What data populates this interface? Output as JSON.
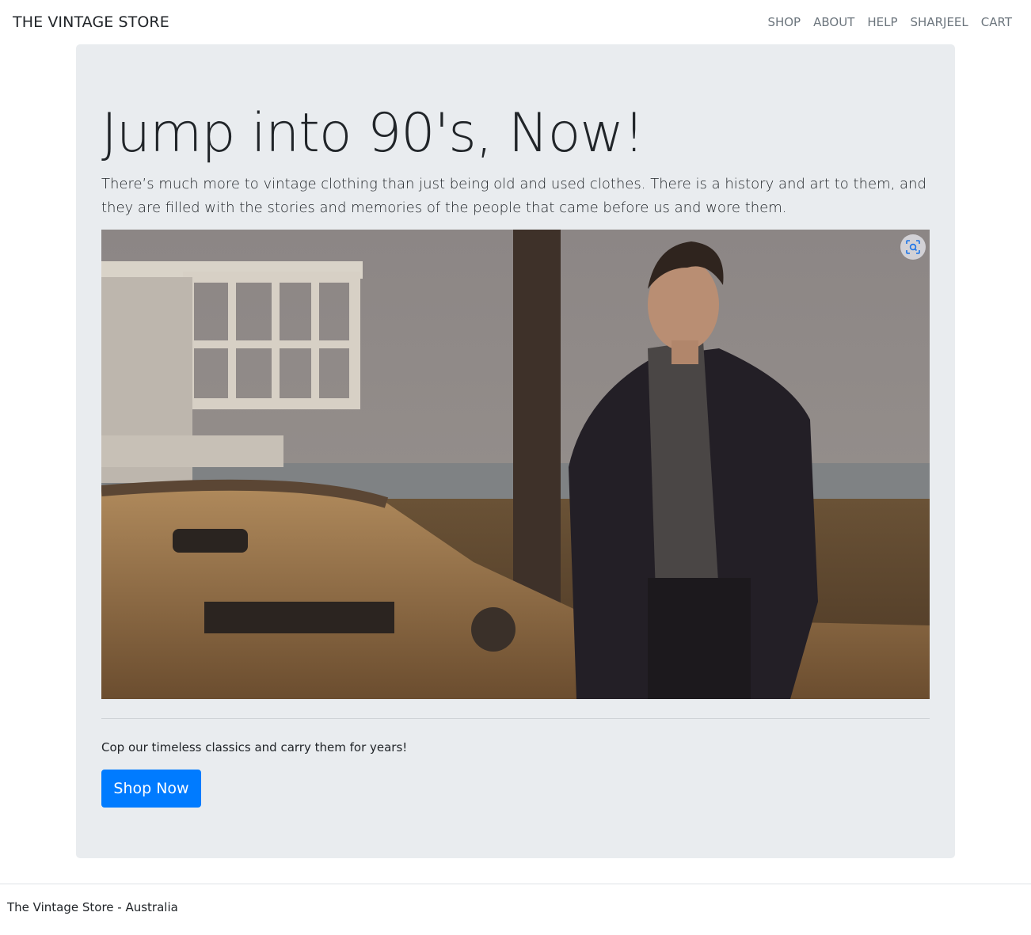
{
  "navbar": {
    "brand": "THE VINTAGE STORE",
    "links": [
      "SHOP",
      "ABOUT",
      "HELP",
      "SHARJEEL",
      "CART"
    ]
  },
  "hero": {
    "title": "Jump into 90's, Now!",
    "lead": "There’s much more to vintage clothing than just being old and used clothes. There is a history and art to them, and they are filled with the stories and memories of the people that came before us and wore them.",
    "tagline": "Cop our timeless classics and carry them for years!",
    "button_label": "Shop Now"
  },
  "footer": {
    "text": "The Vintage Store - Australia"
  },
  "colors": {
    "jumbotron_bg": "#e9ecef",
    "primary": "#007bff",
    "nav_link": "#6c757d",
    "text": "#212529"
  },
  "icons": {
    "visual_search": "visual-search-icon"
  }
}
